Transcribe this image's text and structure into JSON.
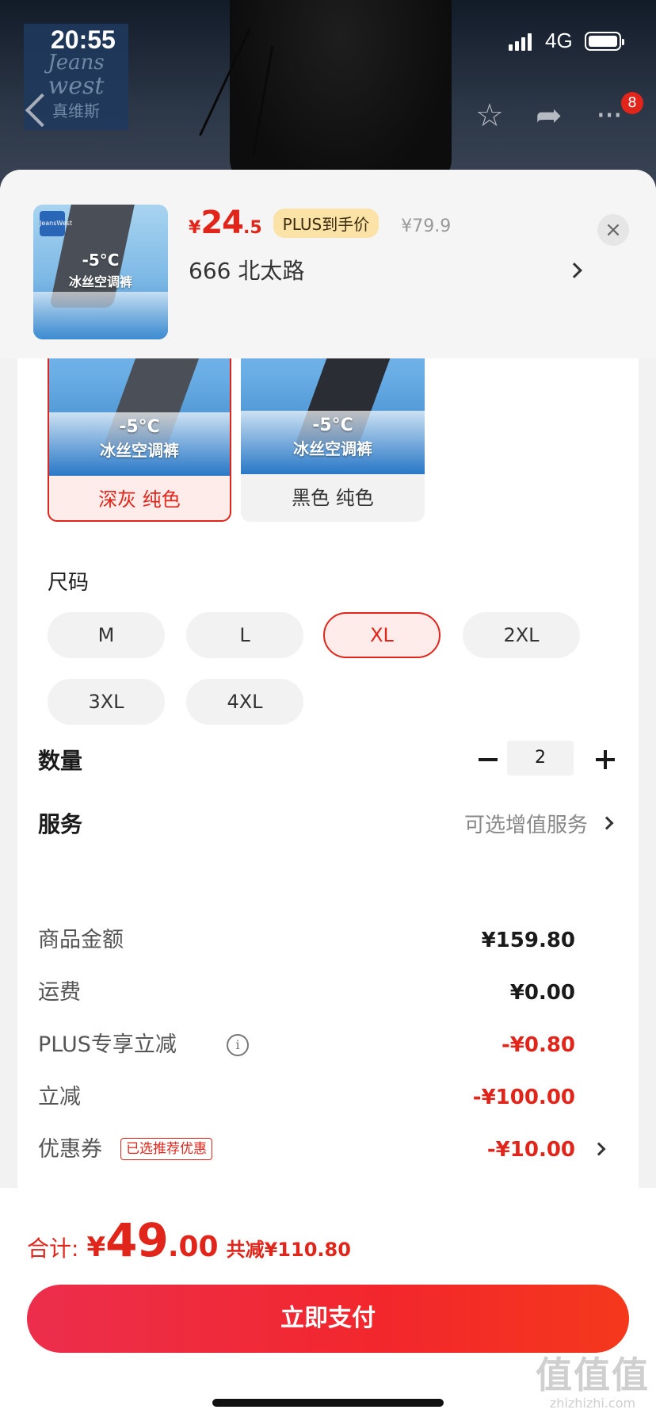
{
  "status_bar": {
    "time": "20:55",
    "network": "4G"
  },
  "background": {
    "brand_lines": [
      "Jeans",
      "west",
      "真维斯"
    ],
    "cart_badge": "8"
  },
  "product": {
    "thumb_brand": "JeansWest",
    "thumb_line1": "-5°C",
    "thumb_line2": "冰丝空调裤",
    "price_symbol": "¥",
    "price_int": "24",
    "price_dec": ".5",
    "plus_tag": "PLUS到手价",
    "original_price": "¥79.9",
    "address": "666  北太路",
    "close_symbol": "×"
  },
  "colors": {
    "options": [
      {
        "label": "深灰 纯色",
        "img_line1": "-5°C",
        "img_line2": "冰丝空调裤",
        "selected": true
      },
      {
        "label": "黑色 纯色",
        "img_line1": "-5°C",
        "img_line2": "冰丝空调裤",
        "selected": false
      }
    ]
  },
  "size": {
    "label": "尺码",
    "options": [
      "M",
      "L",
      "XL",
      "2XL",
      "3XL",
      "4XL"
    ],
    "selected": "XL"
  },
  "quantity": {
    "label": "数量",
    "value": "2"
  },
  "service": {
    "label": "服务",
    "value": "可选增值服务"
  },
  "fees": {
    "goods_label": "商品金额",
    "goods_value": "¥159.80",
    "shipping_label": "运费",
    "shipping_value": "¥0.00",
    "plus_label": "PLUS专享立减",
    "plus_value": "-¥0.80",
    "discount_label": "立减",
    "discount_value": "-¥100.00",
    "coupon_label": "优惠券",
    "coupon_tag": "已选推荐优惠",
    "coupon_value": "-¥10.00"
  },
  "total": {
    "label": "合计:",
    "yen": "¥",
    "int": "49",
    "dec": ".00",
    "saved": "共减¥110.80"
  },
  "pay_button": "立即支付",
  "watermark": {
    "main": "值值值",
    "sub": "zhizhizhi.com"
  },
  "colors_theme": {
    "accent": "#e1251b",
    "plus_tag_bg": "#fbe3a7"
  },
  "icons": [
    "back-icon",
    "star-icon",
    "share-icon",
    "more-icon",
    "info-icon",
    "chevron-right-icon",
    "minus-icon",
    "plus-icon",
    "close-icon"
  ]
}
